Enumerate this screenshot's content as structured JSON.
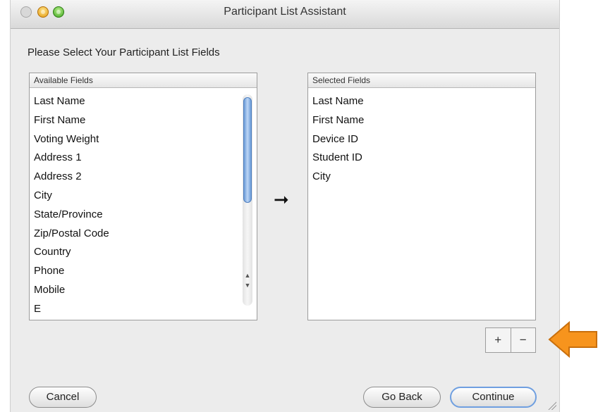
{
  "window": {
    "title": "Participant List Assistant"
  },
  "prompt": "Please Select Your Participant List Fields",
  "available": {
    "header": "Available Fields",
    "items": [
      "Last Name",
      "First Name",
      "Voting Weight",
      "Address 1",
      "Address 2",
      "City",
      "State/Province",
      "Zip/Postal Code",
      "Country",
      "Phone",
      "Mobile",
      "E"
    ]
  },
  "selected": {
    "header": "Selected Fields",
    "items": [
      "Last Name",
      "First Name",
      "Device ID",
      "Student ID",
      "City"
    ]
  },
  "controls": {
    "move_arrow": "➞",
    "plus_label": "+",
    "minus_label": "−"
  },
  "buttons": {
    "cancel": "Cancel",
    "go_back": "Go Back",
    "continue": "Continue"
  },
  "colors": {
    "annotation_arrow": "#f7941d",
    "default_button_border": "#6f9fe0",
    "scroll_thumb": "#6b9bd8"
  },
  "icons": {
    "move": "right-arrow-icon",
    "annotation": "left-arrow-icon"
  }
}
